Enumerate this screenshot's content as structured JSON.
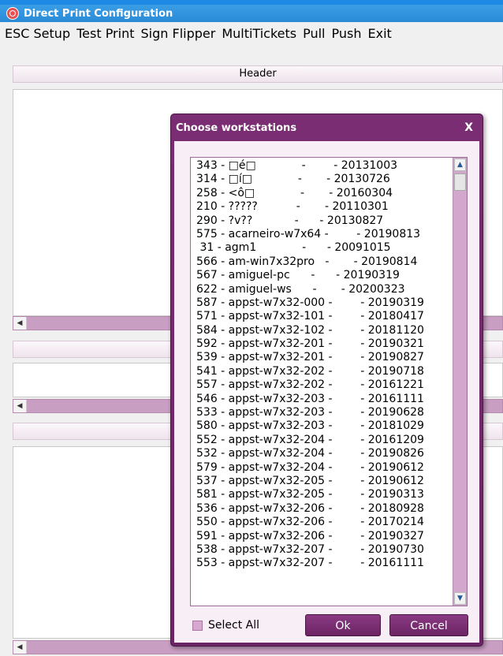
{
  "window": {
    "title": "Direct Print Configuration"
  },
  "menu": [
    "ESC Setup",
    "Test Print",
    "Sign Flipper",
    "MultiTickets",
    "Pull",
    "Push",
    "Exit"
  ],
  "header": {
    "label": "Header"
  },
  "dialog": {
    "title": "Choose workstations",
    "close_label": "X",
    "items": [
      "343 - □é□             -        - 20131003",
      "314 - □í□             -       - 20130726",
      "258 - <ô□             -       - 20160304",
      "210 - ?????           -       - 20110301",
      "290 - ?v??            -      - 20130827",
      "575 - acarneiro-w7x64 -        - 20190813",
      " 31 - agm1             -      - 20091015",
      "566 - am-win7x32pro   -       - 20190814",
      "567 - amiguel-pc      -      - 20190319",
      "622 - amiguel-ws      -       - 20200323",
      "587 - appst-w7x32-000 -        - 20190319",
      "571 - appst-w7x32-101 -        - 20180417",
      "584 - appst-w7x32-102 -        - 20181120",
      "592 - appst-w7x32-201 -        - 20190321",
      "539 - appst-w7x32-201 -        - 20190827",
      "541 - appst-w7x32-202 -        - 20190718",
      "557 - appst-w7x32-202 -        - 20161221",
      "546 - appst-w7x32-203 -        - 20161111",
      "533 - appst-w7x32-203 -        - 20190628",
      "580 - appst-w7x32-203 -        - 20181029",
      "552 - appst-w7x32-204 -        - 20161209",
      "532 - appst-w7x32-204 -        - 20190826",
      "579 - appst-w7x32-204 -        - 20190612",
      "537 - appst-w7x32-205 -        - 20190612",
      "581 - appst-w7x32-205 -        - 20190313",
      "536 - appst-w7x32-206 -        - 20180928",
      "550 - appst-w7x32-206 -        - 20170214",
      "591 - appst-w7x32-206 -        - 20190327",
      "538 - appst-w7x32-207 -        - 20190730",
      "553 - appst-w7x32-207 -        - 20161111"
    ],
    "select_all_label": "Select All",
    "select_all_checked": false,
    "ok_label": "Ok",
    "cancel_label": "Cancel"
  },
  "icons": {
    "app": "app-icon",
    "scroll_left": "arrow-left-icon",
    "scroll_up": "arrow-up-icon",
    "scroll_down": "arrow-down-icon"
  },
  "colors": {
    "titlebar": "#2a8ad6",
    "dialog_frame": "#6b2464",
    "scrollbar": "#c89ec2"
  }
}
